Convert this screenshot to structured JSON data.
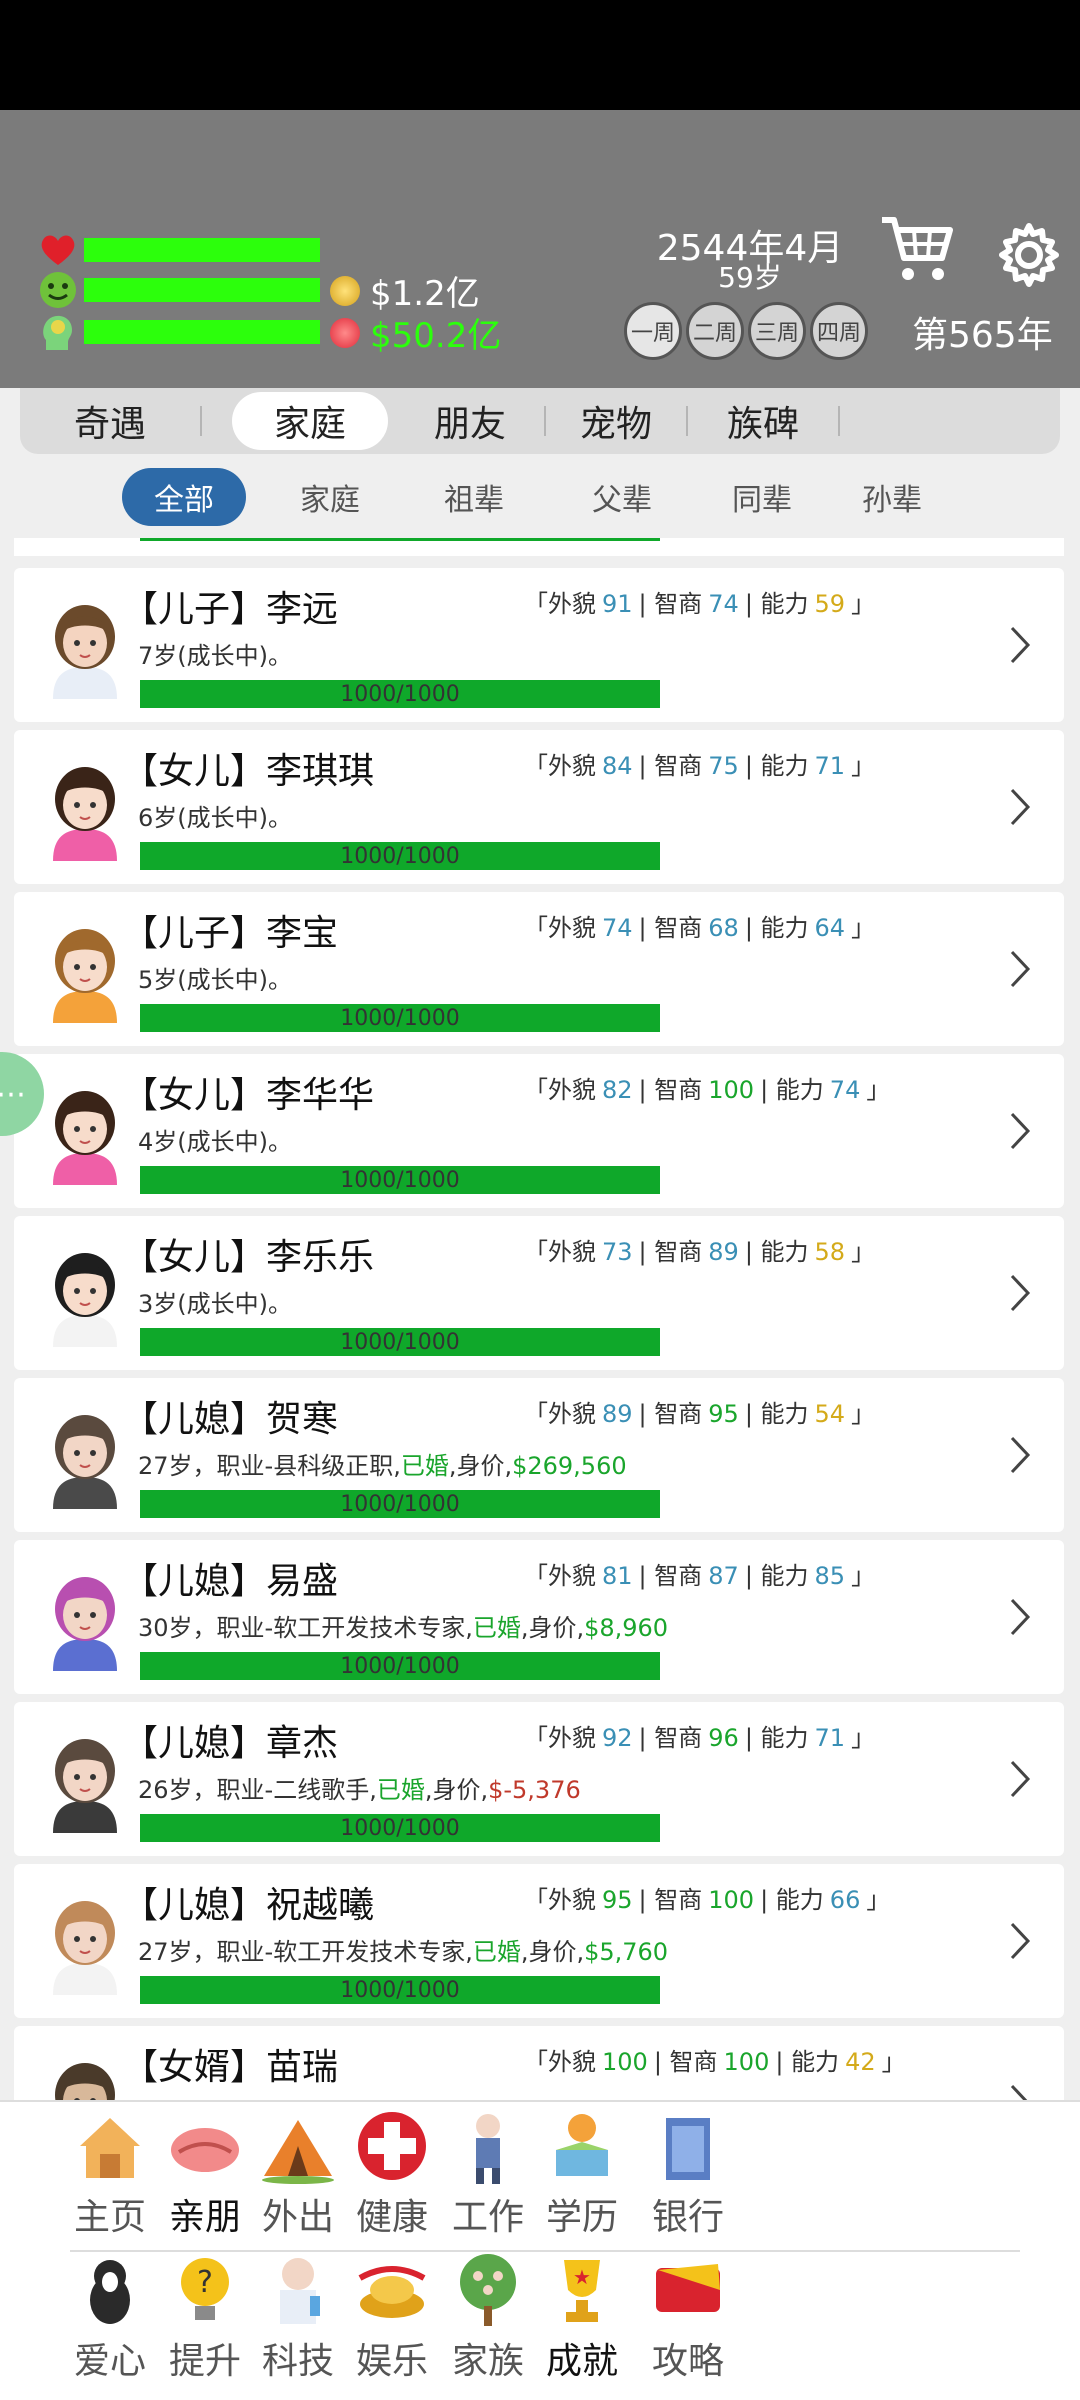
{
  "header": {
    "balances": [
      {
        "icon": "gold-coin-icon",
        "value": "$1.2亿",
        "color": "#ffffff"
      },
      {
        "icon": "red-coin-icon",
        "value": "$50.2亿",
        "color": "#2cff0c"
      }
    ],
    "date": "2544年4月",
    "age": "59岁",
    "weeks": [
      "一周",
      "二周",
      "三周",
      "四周"
    ],
    "generation": "第565年"
  },
  "tabs": [
    "奇遇",
    "家庭",
    "朋友",
    "宠物",
    "族碑"
  ],
  "active_tab": "家庭",
  "subtabs": [
    "全部",
    "家庭",
    "祖辈",
    "父辈",
    "同辈",
    "孙辈"
  ],
  "active_subtab": "全部",
  "attr_labels": {
    "looks": "外貌",
    "iq": "智商",
    "ability": "能力"
  },
  "members": [
    {
      "name": "【儿子】李远",
      "desc_prefix": "7岁(成长中)。",
      "married": "",
      "worth_label": "",
      "worth": "",
      "hp": "1000/1000",
      "looks": "91",
      "iq": "74",
      "ability": "59"
    },
    {
      "name": "【女儿】李琪琪",
      "desc_prefix": "6岁(成长中)。",
      "married": "",
      "worth_label": "",
      "worth": "",
      "hp": "1000/1000",
      "looks": "84",
      "iq": "75",
      "ability": "71"
    },
    {
      "name": "【儿子】李宝",
      "desc_prefix": "5岁(成长中)。",
      "married": "",
      "worth_label": "",
      "worth": "",
      "hp": "1000/1000",
      "looks": "74",
      "iq": "68",
      "ability": "64"
    },
    {
      "name": "【女儿】李华华",
      "desc_prefix": "4岁(成长中)。",
      "married": "",
      "worth_label": "",
      "worth": "",
      "hp": "1000/1000",
      "looks": "82",
      "iq": "100",
      "ability": "74"
    },
    {
      "name": "【女儿】李乐乐",
      "desc_prefix": "3岁(成长中)。",
      "married": "",
      "worth_label": "",
      "worth": "",
      "hp": "1000/1000",
      "looks": "73",
      "iq": "89",
      "ability": "58"
    },
    {
      "name": "【儿媳】贺寒",
      "desc_prefix": "27岁，职业-县科级正职,",
      "married": "已婚",
      "worth_label": ",身价,",
      "worth": "$269,560",
      "hp": "1000/1000",
      "looks": "89",
      "iq": "95",
      "ability": "54"
    },
    {
      "name": "【儿媳】易盛",
      "desc_prefix": "30岁，职业-软工开发技术专家,",
      "married": "已婚",
      "worth_label": ",身价,",
      "worth": "$8,960",
      "hp": "1000/1000",
      "looks": "81",
      "iq": "87",
      "ability": "85"
    },
    {
      "name": "【儿媳】章杰",
      "desc_prefix": "26岁，职业-二线歌手,",
      "married": "已婚",
      "worth_label": ",身价,",
      "worth": "$-5,376",
      "hp": "1000/1000",
      "looks": "92",
      "iq": "96",
      "ability": "71"
    },
    {
      "name": "【儿媳】祝越曦",
      "desc_prefix": "27岁，职业-软工开发技术专家,",
      "married": "已婚",
      "worth_label": ",身价,",
      "worth": "$5,760",
      "hp": "1000/1000",
      "looks": "95",
      "iq": "100",
      "ability": "66"
    },
    {
      "name": "【女婿】苗瑞",
      "desc_prefix": "",
      "married": "",
      "worth_label": "",
      "worth": "",
      "hp": "",
      "looks": "100",
      "iq": "100",
      "ability": "42"
    }
  ],
  "nav_row1": [
    {
      "label": "主页",
      "icon": "home-icon"
    },
    {
      "label": "亲朋",
      "icon": "handshake-icon"
    },
    {
      "label": "外出",
      "icon": "tent-icon"
    },
    {
      "label": "健康",
      "icon": "red-cross-icon"
    },
    {
      "label": "工作",
      "icon": "worker-icon"
    },
    {
      "label": "学历",
      "icon": "study-icon"
    },
    {
      "label": "银行",
      "icon": "bank-icon"
    }
  ],
  "nav_row2": [
    {
      "label": "爱心",
      "icon": "dog-icon"
    },
    {
      "label": "提升",
      "icon": "lightbulb-icon"
    },
    {
      "label": "科技",
      "icon": "scientist-icon"
    },
    {
      "label": "娱乐",
      "icon": "gold-ingot-icon"
    },
    {
      "label": "家族",
      "icon": "family-tree-icon"
    },
    {
      "label": "成就",
      "icon": "trophy-icon"
    },
    {
      "label": "攻略",
      "icon": "tips-icon"
    }
  ],
  "nav_active": [
    "亲朋",
    "成就"
  ],
  "colors": {
    "header_bg": "#7b7b7b",
    "stat_bar": "#2cff0c",
    "hp_bar": "#0fa82a",
    "subtab_active": "#2d6aa8"
  }
}
